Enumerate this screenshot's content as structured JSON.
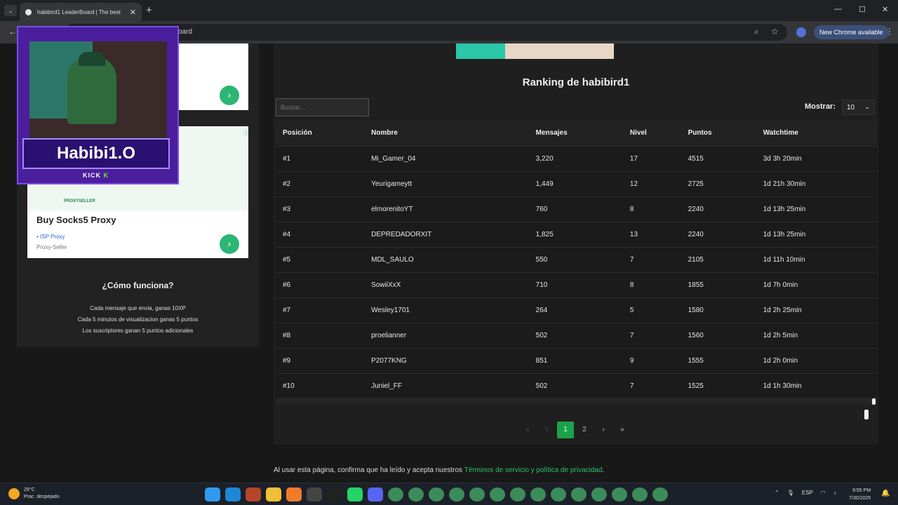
{
  "browser": {
    "tab_title": "habibird1 LeaderBoard | The best",
    "tab_close": "✕",
    "tabs_menu": "⌄",
    "new_tab": "+",
    "url_visible": "oard",
    "new_chrome": "New Chrome available",
    "menu": "⋮",
    "minimize": "—",
    "maximize": "☐",
    "close": "✕"
  },
  "stream_overlay": {
    "name": "Habibi1.O",
    "platform": "KICK",
    "platform_mark": "K"
  },
  "ad": {
    "brand": "PROXYSELLER",
    "headline": "Buy Socks5 Proxy",
    "bullet": "ISP Proxy",
    "source": "Proxy-Seller",
    "arrow": "›"
  },
  "how": {
    "title": "¿Cómo funciona?",
    "lines": [
      "Cada mensaje que envia, ganas 10XP",
      "Cada 5 minutos de visualizacion ganas 5 puntos",
      "Los suscriptores ganan 5 puntos adicionales"
    ]
  },
  "leaderboard": {
    "title": "Ranking de habibird1",
    "search_placeholder": "Buscar...",
    "show_label": "Mostrar:",
    "show_value": "10",
    "columns": [
      "Posición",
      "Nombre",
      "Mensajes",
      "Nivel",
      "Puntos",
      "Watchtime"
    ],
    "rows": [
      [
        "#1",
        "Mi_Gamer_04",
        "3,220",
        "17",
        "4515",
        "3d 3h 20min"
      ],
      [
        "#2",
        "Yeurigameytt",
        "1,449",
        "12",
        "2725",
        "1d 21h 30min"
      ],
      [
        "#3",
        "elmorenitoYT",
        "760",
        "8",
        "2240",
        "1d 13h 25min"
      ],
      [
        "#4",
        "DEPREDADORXIT",
        "1,825",
        "13",
        "2240",
        "1d 13h 25min"
      ],
      [
        "#5",
        "MDL_SAULO",
        "550",
        "7",
        "2105",
        "1d 11h 10min"
      ],
      [
        "#6",
        "SowiiXxX",
        "710",
        "8",
        "1855",
        "1d 7h 0min"
      ],
      [
        "#7",
        "Wesley1701",
        "264",
        "5",
        "1580",
        "1d 2h 25min"
      ],
      [
        "#8",
        "proelianner",
        "502",
        "7",
        "1560",
        "1d 2h 5min"
      ],
      [
        "#9",
        "P2077KNG",
        "851",
        "9",
        "1555",
        "1d 2h 0min"
      ],
      [
        "#10",
        "Juniel_FF",
        "502",
        "7",
        "1525",
        "1d 1h 30min"
      ]
    ],
    "pagination": {
      "first": "«",
      "prev": "‹",
      "pages": [
        "1",
        "2"
      ],
      "current": "1",
      "next": "›",
      "last": "»"
    }
  },
  "footer": {
    "text": "Al usar esta página, confirma que ha leído y acepta nuestros ",
    "link": "Términos de servicio y política de privacidad",
    "end": "."
  },
  "taskbar": {
    "temp": "29°C",
    "weather": "Prac. despejado",
    "lang": "ESP",
    "time": "9:55 PM",
    "date": "7/30/2025",
    "apps": [
      "windows",
      "edge",
      "app",
      "files",
      "app",
      "app",
      "terminal",
      "whatsapp",
      "discord",
      "chrome",
      "chrome",
      "chrome",
      "chrome",
      "chrome",
      "chrome",
      "chrome",
      "chrome",
      "chrome",
      "chrome",
      "chrome",
      "chrome",
      "chrome",
      "chrome"
    ],
    "app_colors": [
      "#2f9bf0",
      "#1e88d6",
      "#b5452a",
      "#f2c037",
      "#f07b2a",
      "#444",
      "#222",
      "#25d366",
      "#5865f2",
      "#3b8c5a",
      "#3b8c5a",
      "#3b8c5a",
      "#3b8c5a",
      "#3b8c5a",
      "#3b8c5a",
      "#3b8c5a",
      "#3b8c5a",
      "#3b8c5a",
      "#3b8c5a",
      "#3b8c5a",
      "#3b8c5a",
      "#3b8c5a",
      "#3b8c5a"
    ]
  }
}
